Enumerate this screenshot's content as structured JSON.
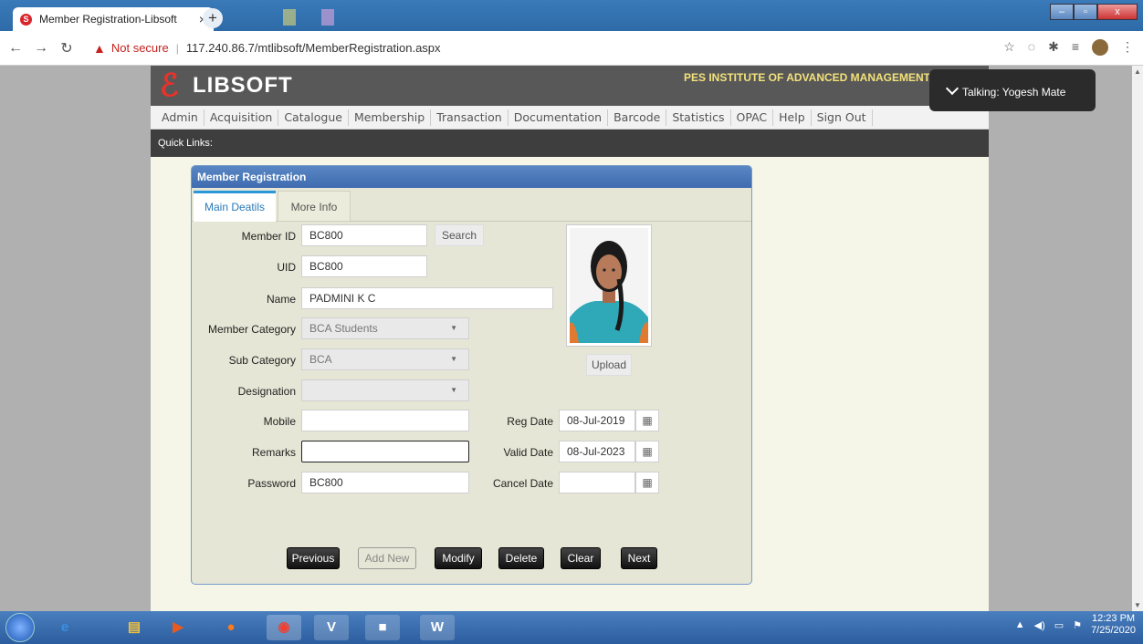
{
  "browser": {
    "tab_title": "Member Registration-Libsoft",
    "tab_close": "×",
    "new_tab": "+",
    "not_secure": "Not secure",
    "url": "117.240.86.7/mtlibsoft/MemberRegistration.aspx"
  },
  "site": {
    "logo_mark": "ℰ",
    "logo_text": "LIBSOFT",
    "institution": "PES INSTITUTE OF ADVANCED MANAGEMENT",
    "menu": [
      "Admin",
      "Acquisition",
      "Catalogue",
      "Membership",
      "Transaction",
      "Documentation",
      "Barcode",
      "Statistics",
      "OPAC",
      "Help",
      "Sign Out"
    ],
    "quick_links": "Quick Links:"
  },
  "form": {
    "panel_title": "Member Registration",
    "tab_main": "Main Deatils",
    "tab_more": "More Info",
    "member_id_label": "Member ID",
    "member_id": "BC800",
    "search_label": "Search",
    "uid_label": "UID",
    "uid": "BC800",
    "name_label": "Name",
    "name": "PADMINI K C",
    "member_category_label": "Member Category",
    "member_category": "BCA Students",
    "sub_category_label": "Sub Category",
    "sub_category": "BCA",
    "designation_label": "Designation",
    "designation": "",
    "mobile_label": "Mobile",
    "mobile": "",
    "remarks_label": "Remarks",
    "remarks": "",
    "password_label": "Password",
    "password": "BC800",
    "reg_date_label": "Reg Date",
    "reg_date": "08-Jul-2019",
    "valid_date_label": "Valid Date",
    "valid_date": "08-Jul-2023",
    "cancel_date_label": "Cancel Date",
    "cancel_date": "",
    "upload_label": "Upload",
    "buttons": {
      "previous": "Previous",
      "add_new": "Add New",
      "modify": "Modify",
      "delete": "Delete",
      "clear": "Clear",
      "next": "Next"
    }
  },
  "overlay": {
    "talking": "Talking: Yogesh Mate"
  },
  "taskbar": {
    "time": "12:23 PM",
    "date": "7/25/2020"
  },
  "colors": {
    "header_bg": "#585858",
    "institution_text": "#f3e27a",
    "logo_red": "#e8322b",
    "panel_head": "#4a78ba",
    "active_tab_accent": "#2a98d8"
  }
}
